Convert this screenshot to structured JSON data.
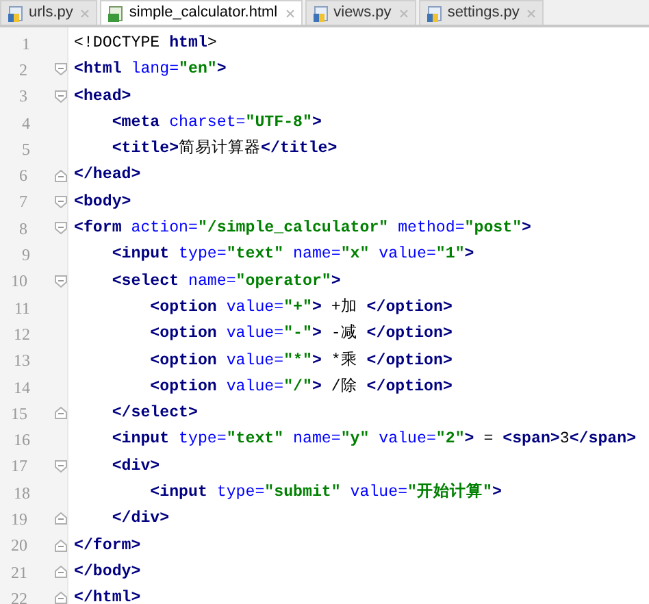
{
  "tabs": [
    {
      "label": "urls.py",
      "kind": "python",
      "selected": false
    },
    {
      "label": "simple_calculator.html",
      "kind": "html",
      "selected": true
    },
    {
      "label": "views.py",
      "kind": "python",
      "selected": false
    },
    {
      "label": "settings.py",
      "kind": "python",
      "selected": false
    }
  ],
  "lines": [
    {
      "number": "1",
      "tokens": [
        {
          "kind": "plain",
          "text": "<!DOCTYPE"
        },
        {
          "kind": "tag",
          "text": " html"
        },
        {
          "kind": "plain",
          "text": ">"
        }
      ]
    },
    {
      "number": "2",
      "fold_start": true,
      "tokens": [
        {
          "kind": "tag",
          "text": "<html"
        },
        {
          "kind": "attr",
          "text": " lang="
        },
        {
          "kind": "str",
          "text": "\"en\""
        },
        {
          "kind": "tag",
          "text": ">"
        }
      ]
    },
    {
      "number": "3",
      "fold_start": true,
      "tokens": [
        {
          "kind": "tag",
          "text": "<head>"
        }
      ]
    },
    {
      "number": "4",
      "tokens": [
        {
          "kind": "tag",
          "text": "    <meta"
        },
        {
          "kind": "attr",
          "text": " charset="
        },
        {
          "kind": "str",
          "text": "\"UTF-8\""
        },
        {
          "kind": "tag",
          "text": ">"
        }
      ]
    },
    {
      "number": "5",
      "tokens": [
        {
          "kind": "tag",
          "text": "    <title>"
        },
        {
          "kind": "plain",
          "text": "简易计算器"
        },
        {
          "kind": "tag",
          "text": "</title>"
        }
      ]
    },
    {
      "number": "6",
      "fold_end": true,
      "tokens": [
        {
          "kind": "tag",
          "text": "</head>"
        }
      ]
    },
    {
      "number": "7",
      "fold_start": true,
      "tokens": [
        {
          "kind": "tag",
          "text": "<body>"
        }
      ]
    },
    {
      "number": "8",
      "fold_start": true,
      "tokens": [
        {
          "kind": "tag",
          "text": "<form"
        },
        {
          "kind": "attr",
          "text": " action="
        },
        {
          "kind": "str",
          "text": "\"/simple_calculator\""
        },
        {
          "kind": "attr",
          "text": " method="
        },
        {
          "kind": "str",
          "text": "\"post\""
        },
        {
          "kind": "tag",
          "text": ">"
        }
      ]
    },
    {
      "number": "9",
      "tokens": [
        {
          "kind": "tag",
          "text": "    <input"
        },
        {
          "kind": "attr",
          "text": " type="
        },
        {
          "kind": "str",
          "text": "\"text\""
        },
        {
          "kind": "attr",
          "text": " name="
        },
        {
          "kind": "str",
          "text": "\"x\""
        },
        {
          "kind": "attr",
          "text": " value="
        },
        {
          "kind": "str",
          "text": "\"1\""
        },
        {
          "kind": "tag",
          "text": ">"
        }
      ]
    },
    {
      "number": "10",
      "fold_start": true,
      "tokens": [
        {
          "kind": "tag",
          "text": "    <select"
        },
        {
          "kind": "attr",
          "text": " name="
        },
        {
          "kind": "str",
          "text": "\"operator\""
        },
        {
          "kind": "tag",
          "text": ">"
        }
      ]
    },
    {
      "number": "11",
      "tokens": [
        {
          "kind": "tag",
          "text": "        <option"
        },
        {
          "kind": "attr",
          "text": " value="
        },
        {
          "kind": "str",
          "text": "\"+\""
        },
        {
          "kind": "tag",
          "text": ">"
        },
        {
          "kind": "plain",
          "text": " +加 "
        },
        {
          "kind": "tag",
          "text": "</option>"
        }
      ]
    },
    {
      "number": "12",
      "tokens": [
        {
          "kind": "tag",
          "text": "        <option"
        },
        {
          "kind": "attr",
          "text": " value="
        },
        {
          "kind": "str",
          "text": "\"-\""
        },
        {
          "kind": "tag",
          "text": ">"
        },
        {
          "kind": "plain",
          "text": " -减 "
        },
        {
          "kind": "tag",
          "text": "</option>"
        }
      ]
    },
    {
      "number": "13",
      "tokens": [
        {
          "kind": "tag",
          "text": "        <option"
        },
        {
          "kind": "attr",
          "text": " value="
        },
        {
          "kind": "str",
          "text": "\"*\""
        },
        {
          "kind": "tag",
          "text": ">"
        },
        {
          "kind": "plain",
          "text": " *乘 "
        },
        {
          "kind": "tag",
          "text": "</option>"
        }
      ]
    },
    {
      "number": "14",
      "tokens": [
        {
          "kind": "tag",
          "text": "        <option"
        },
        {
          "kind": "attr",
          "text": " value="
        },
        {
          "kind": "str",
          "text": "\"/\""
        },
        {
          "kind": "tag",
          "text": ">"
        },
        {
          "kind": "plain",
          "text": " /除 "
        },
        {
          "kind": "tag",
          "text": "</option>"
        }
      ]
    },
    {
      "number": "15",
      "fold_end": true,
      "tokens": [
        {
          "kind": "tag",
          "text": "    </select>"
        }
      ]
    },
    {
      "number": "16",
      "tokens": [
        {
          "kind": "tag",
          "text": "    <input"
        },
        {
          "kind": "attr",
          "text": " type="
        },
        {
          "kind": "str",
          "text": "\"text\""
        },
        {
          "kind": "attr",
          "text": " name="
        },
        {
          "kind": "str",
          "text": "\"y\""
        },
        {
          "kind": "attr",
          "text": " value="
        },
        {
          "kind": "str",
          "text": "\"2\""
        },
        {
          "kind": "tag",
          "text": ">"
        },
        {
          "kind": "plain",
          "text": " = "
        },
        {
          "kind": "tag",
          "text": "<span>"
        },
        {
          "kind": "plain",
          "text": "3"
        },
        {
          "kind": "tag",
          "text": "</span>"
        }
      ]
    },
    {
      "number": "17",
      "fold_start": true,
      "tokens": [
        {
          "kind": "tag",
          "text": "    <div>"
        }
      ]
    },
    {
      "number": "18",
      "tokens": [
        {
          "kind": "tag",
          "text": "        <input"
        },
        {
          "kind": "attr",
          "text": " type="
        },
        {
          "kind": "str",
          "text": "\"submit\""
        },
        {
          "kind": "attr",
          "text": " value="
        },
        {
          "kind": "str",
          "text": "\"开始计算\""
        },
        {
          "kind": "tag",
          "text": ">"
        }
      ]
    },
    {
      "number": "19",
      "fold_end": true,
      "tokens": [
        {
          "kind": "tag",
          "text": "    </div>"
        }
      ]
    },
    {
      "number": "20",
      "fold_end": true,
      "tokens": [
        {
          "kind": "tag",
          "text": "</form>"
        }
      ]
    },
    {
      "number": "21",
      "fold_end": true,
      "tokens": [
        {
          "kind": "tag",
          "text": "</body>"
        }
      ]
    },
    {
      "number": "22",
      "fold_end": true,
      "tokens": [
        {
          "kind": "tag",
          "text": "</html>"
        }
      ]
    }
  ]
}
